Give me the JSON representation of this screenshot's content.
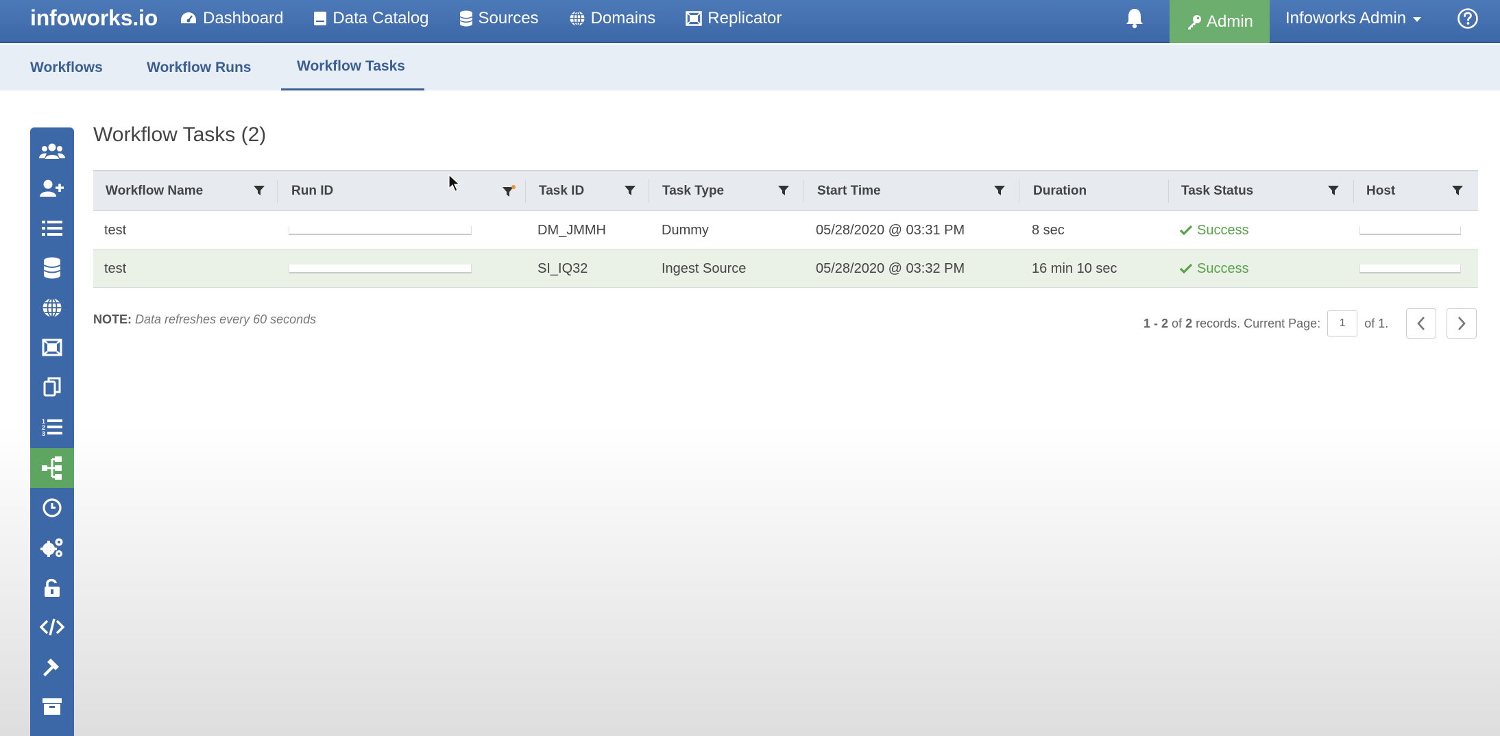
{
  "brand": "infoworks.io",
  "nav": [
    {
      "label": "Dashboard",
      "icon": "dashboard-icon"
    },
    {
      "label": "Data Catalog",
      "icon": "catalog-icon"
    },
    {
      "label": "Sources",
      "icon": "database-icon"
    },
    {
      "label": "Domains",
      "icon": "globe-icon"
    },
    {
      "label": "Replicator",
      "icon": "replicator-icon"
    }
  ],
  "admin_label": "Admin",
  "user_label": "Infoworks Admin",
  "subtabs": [
    "Workflows",
    "Workflow Runs",
    "Workflow Tasks"
  ],
  "active_subtab": "Workflow Tasks",
  "page_title": "Workflow Tasks (2)",
  "columns": [
    "Workflow Name",
    "Run ID",
    "Task ID",
    "Task Type",
    "Start Time",
    "Duration",
    "Task Status",
    "Host"
  ],
  "rows": [
    {
      "workflow_name": "test",
      "task_id": "DM_JMMH",
      "task_type": "Dummy",
      "start_time": "05/28/2020 @ 03:31 PM",
      "duration": "8 sec",
      "status": "Success"
    },
    {
      "workflow_name": "test",
      "task_id": "SI_IQ32",
      "task_type": "Ingest Source",
      "start_time": "05/28/2020 @ 03:32 PM",
      "duration": "16 min 10 sec",
      "status": "Success"
    }
  ],
  "note": {
    "label": "NOTE:",
    "text": "Data refreshes every 60 seconds"
  },
  "pager": {
    "range": "1 - 2",
    "of": "of",
    "total": "2",
    "records_text": "records. Current Page:",
    "page": "1",
    "of_pages": "of 1."
  },
  "rail_icons": [
    "users-icon",
    "add-user-icon",
    "list-icon",
    "database-icon",
    "globe-icon",
    "replicator-icon",
    "copy-icon",
    "ordered-list-icon",
    "workflow-icon",
    "clock-icon",
    "cogs-icon",
    "unlock-icon",
    "code-icon",
    "hammer-icon",
    "archive-icon"
  ],
  "colors": {
    "navbar": "#3d68a8",
    "admin": "#6cae6e",
    "success": "#5aa14b",
    "active_rail": "#5ea562"
  }
}
